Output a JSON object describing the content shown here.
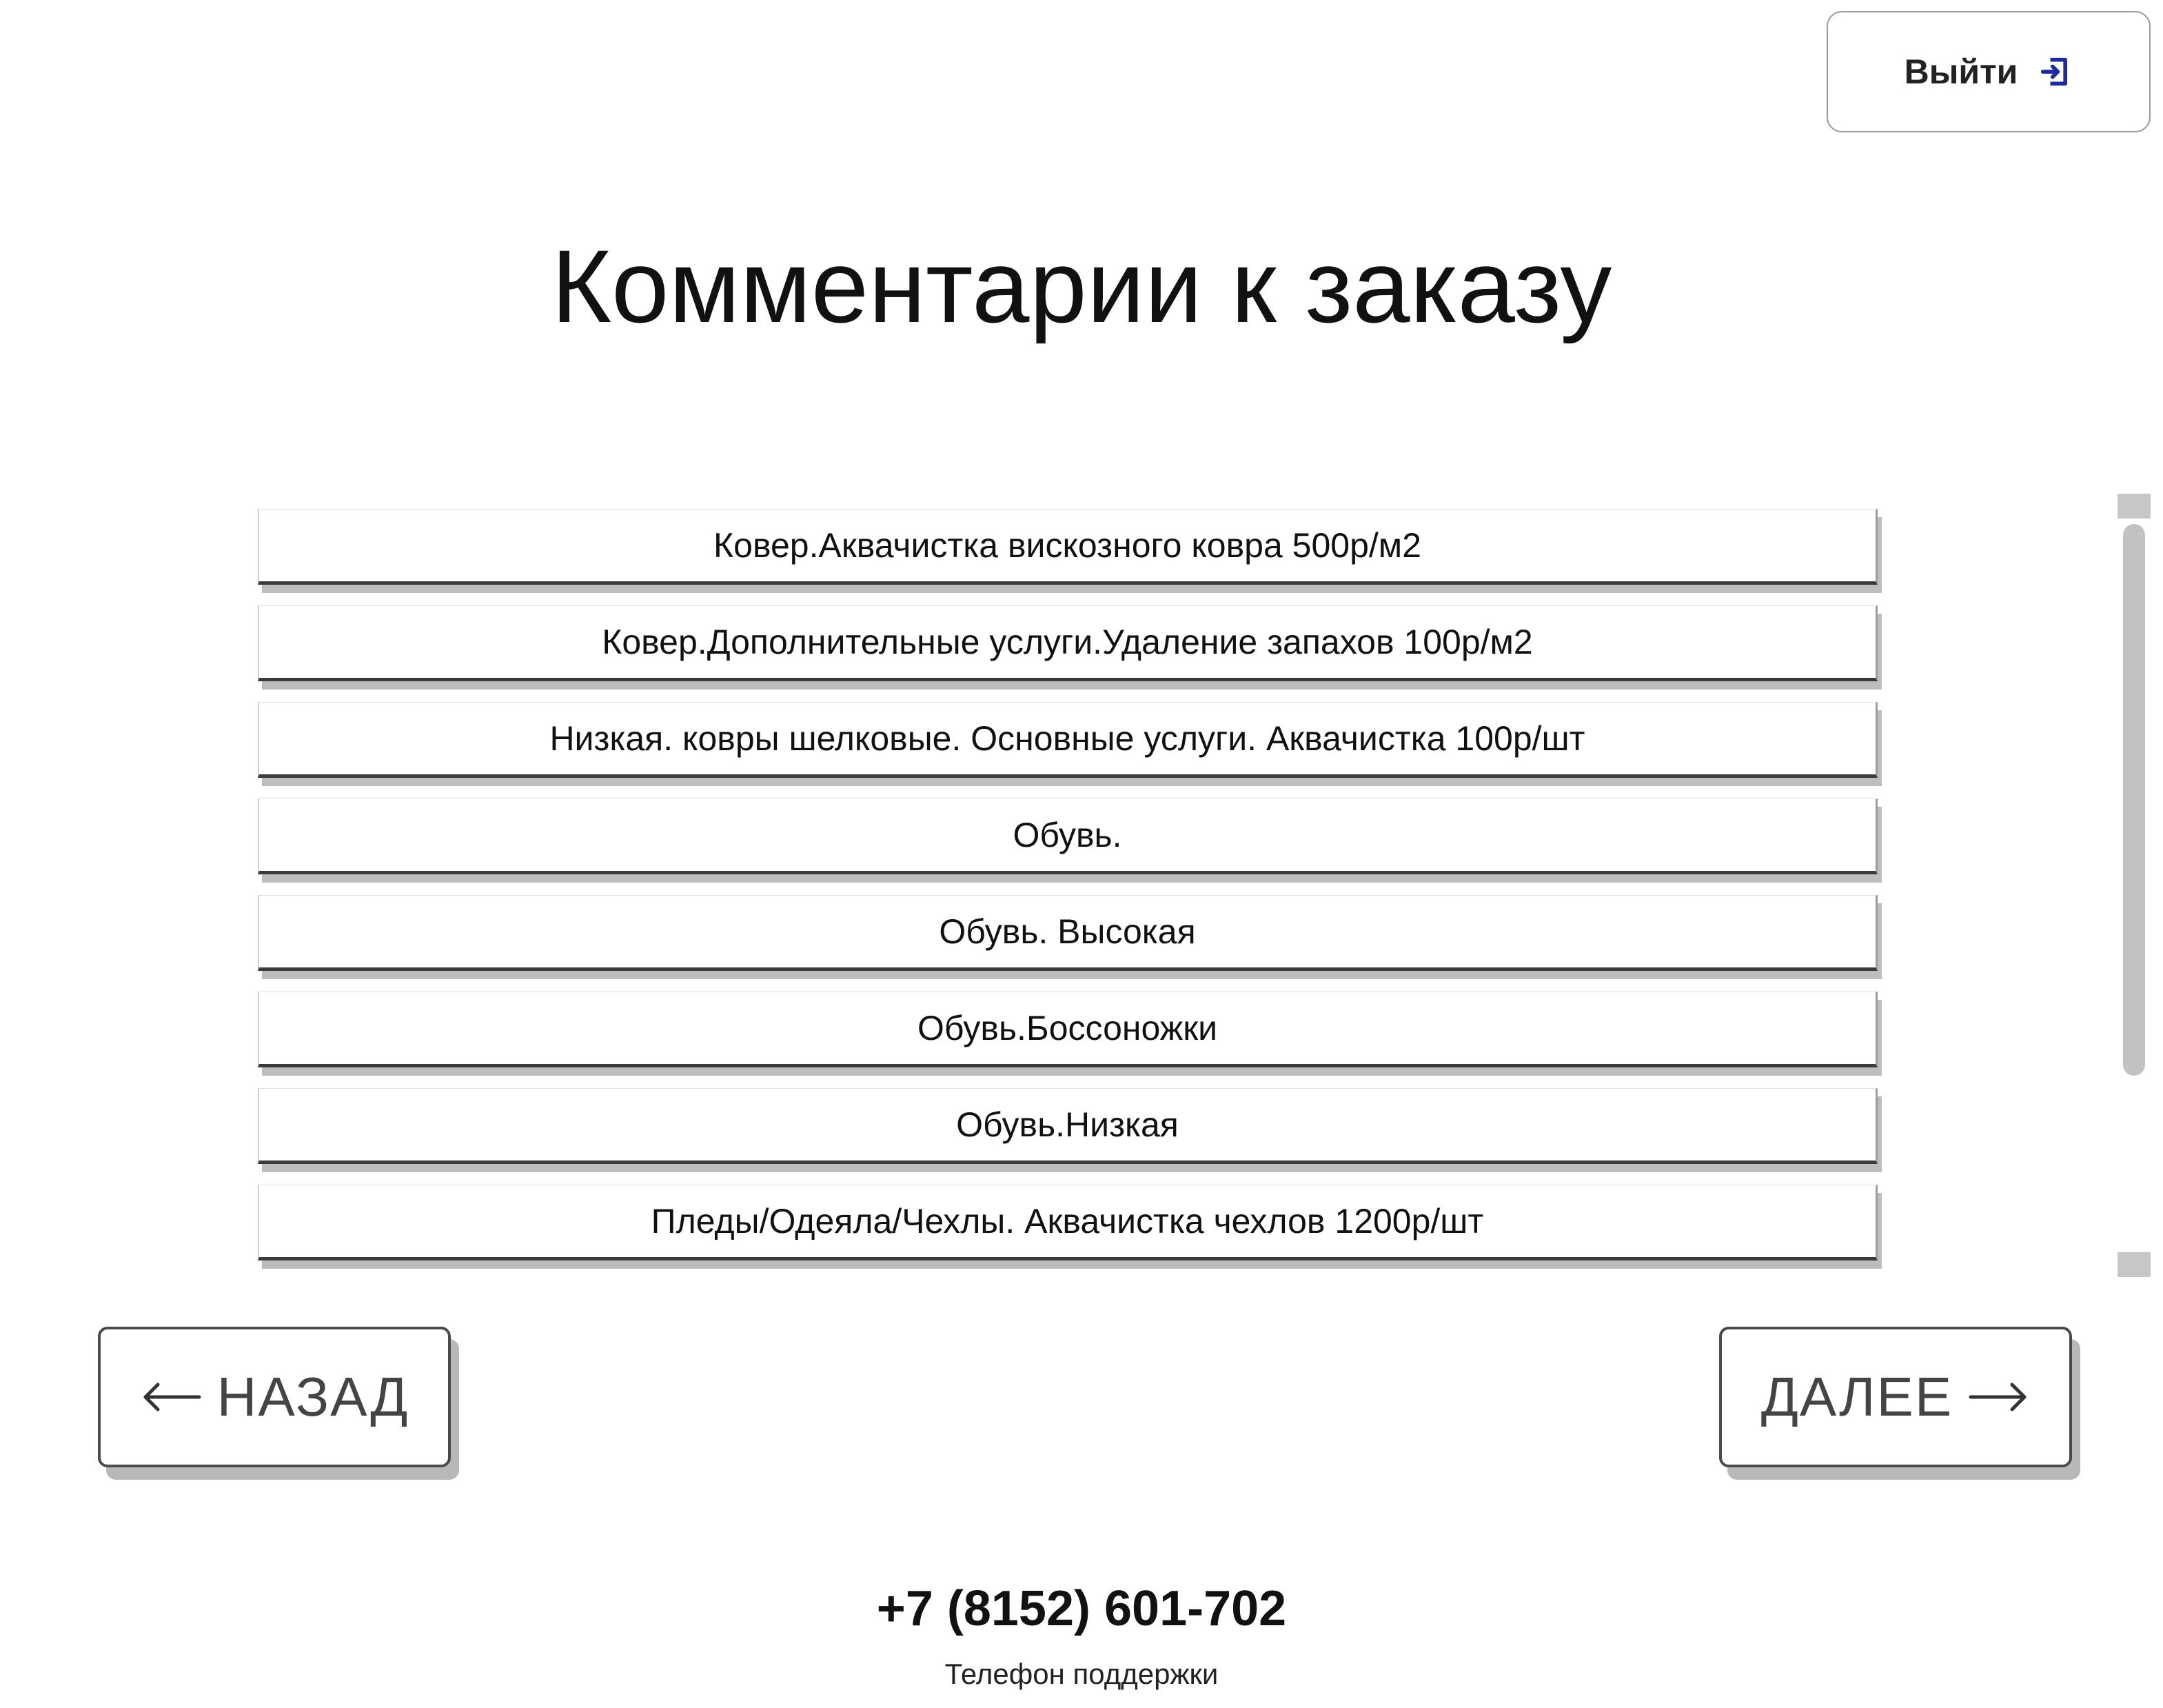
{
  "header": {
    "exit_label": "Выйти"
  },
  "page": {
    "title": "Комментарии к заказу"
  },
  "comments": {
    "items": [
      "Ковер.Аквачистка вискозного ковра 500р/м2",
      "Ковер.Дополнительные услуги.Удаление запахов 100р/м2",
      "Низкая. ковры шелковые. Основные услуги. Аквачистка 100р/шт",
      "Обувь.",
      "Обувь. Высокая",
      "Обувь.Боссоножки",
      "Обувь.Низкая",
      "Пледы/Одеяла/Чехлы. Аквачистка чехлов 1200р/шт"
    ]
  },
  "navigation": {
    "back_label": "НАЗАД",
    "next_label": "ДАЛЕЕ"
  },
  "footer": {
    "phone": "+7 (8152) 601-702",
    "caption": "Телефон поддержки"
  },
  "icons": {
    "exit": "exit-icon",
    "back": "arrow-left-icon",
    "next": "arrow-right-icon"
  },
  "colors": {
    "exit_icon": "#1f2a9c",
    "text": "#111111",
    "nav_text": "#444444",
    "scrollbar": "#c2c2c2"
  }
}
